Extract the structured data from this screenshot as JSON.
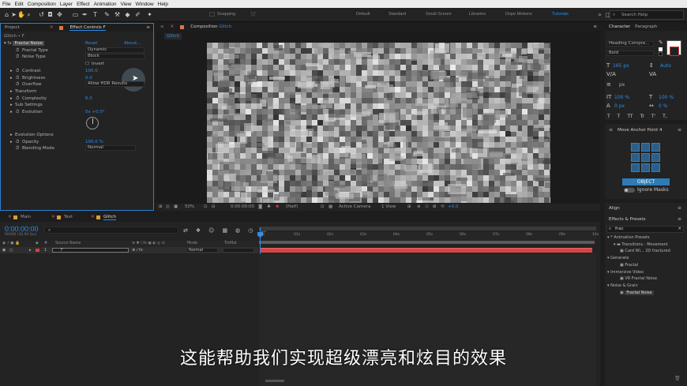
{
  "menu": [
    "File",
    "Edit",
    "Composition",
    "Layer",
    "Effect",
    "Animation",
    "View",
    "Window",
    "Help"
  ],
  "toolbar": {
    "snapping_label": "Snapping",
    "workspaces": [
      {
        "label": "Default",
        "active": false
      },
      {
        "label": "Standard",
        "active": false
      },
      {
        "label": "Small Screen",
        "active": false
      },
      {
        "label": "Libraries",
        "active": false
      },
      {
        "label": "Dope Motions",
        "active": false
      },
      {
        "label": "Tutorials",
        "active": true
      }
    ],
    "search_placeholder": "Search Help"
  },
  "effect_controls": {
    "tab_project": "Project",
    "tab_effect": "Effect Controls F",
    "breadcrumb": "Glitch • F",
    "effect_name": "Fractal Noise",
    "reset": "Reset",
    "about": "About...",
    "props": [
      {
        "label": "Fractal Type",
        "value": "Dynamic",
        "kind": "dropdown"
      },
      {
        "label": "Noise Type",
        "value": "Block",
        "kind": "dropdown"
      },
      {
        "label": "",
        "value": "Invert",
        "kind": "checkbox"
      },
      {
        "label": "Contrast",
        "value": "100.0",
        "kind": "number"
      },
      {
        "label": "Brightness",
        "value": "0.0",
        "kind": "number"
      },
      {
        "label": "Overflow",
        "value": "Allow HDR Results",
        "kind": "dropdown"
      },
      {
        "label": "Transform",
        "value": "",
        "kind": "group"
      },
      {
        "label": "Complexity",
        "value": "6.0",
        "kind": "number"
      },
      {
        "label": "Sub Settings",
        "value": "",
        "kind": "group"
      },
      {
        "label": "Evolution",
        "value": "0x +0.0°",
        "kind": "number"
      },
      {
        "label": "Evolution Options",
        "value": "",
        "kind": "group"
      },
      {
        "label": "Opacity",
        "value": "100.0 %",
        "kind": "number"
      },
      {
        "label": "Blending Mode",
        "value": "Normal",
        "kind": "dropdown"
      }
    ]
  },
  "composition": {
    "tab_label": "Composition",
    "comp_name": "Glitch",
    "subtab": "Glitch",
    "zoom": "50%",
    "timecode": "0:00:00:00",
    "resolution": "(Half)",
    "camera": "Active Camera",
    "views": "1 View",
    "exposure": "+0.0"
  },
  "character": {
    "tab_character": "Character",
    "tab_paragraph": "Paragraph",
    "font": "Heading Compre...",
    "style": "Bold",
    "size": "165 px",
    "leading": "Auto",
    "tracking_unit": "px",
    "v_scale": "100 %",
    "h_scale": "100 %",
    "baseline": "0 px",
    "tsume": "0 %",
    "style_buttons": [
      "T",
      "T",
      "TT",
      "Tr",
      "T'",
      "T,"
    ]
  },
  "anchor_panel": {
    "title": "Move Anchor Point 4",
    "object_button": "OBJECT",
    "ignore_masks": "Ignore Masks"
  },
  "align": {
    "title": "Align"
  },
  "effects_presets": {
    "title": "Effects & Presets",
    "search_value": "frac",
    "tree": [
      {
        "label": "* Animation Presets",
        "level": 0
      },
      {
        "label": "Transitions - Movement",
        "level": 1
      },
      {
        "label": "Card Wi... 2D fractured",
        "level": 2
      },
      {
        "label": "Generate",
        "level": 0
      },
      {
        "label": "Fractal",
        "level": 2
      },
      {
        "label": "Immersive Video",
        "level": 0
      },
      {
        "label": "VR Fractal Noise",
        "level": 2
      },
      {
        "label": "Noise & Grain",
        "level": 0
      },
      {
        "label": "Fractal Noise",
        "level": 2,
        "selected": true
      }
    ]
  },
  "timeline": {
    "tabs": [
      {
        "label": "Main",
        "active": false
      },
      {
        "label": "Text",
        "active": false
      },
      {
        "label": "Glitch",
        "active": true
      }
    ],
    "timecode": "0:00:00:00",
    "frame_info": "00000 (30.00 fps)",
    "col_source": "Source Name",
    "col_mode": "Mode",
    "col_trkmat": "TrkMat",
    "layer_num": "1",
    "layer_name": "F",
    "layer_mode": "Normal",
    "ruler": [
      "0s",
      "01s",
      "02s",
      "03s",
      "04s",
      "05s",
      "06s",
      "07s",
      "08s",
      "09s",
      "10s"
    ]
  },
  "subtitle": "这能帮助我们实现超级漂亮和炫目的效果"
}
